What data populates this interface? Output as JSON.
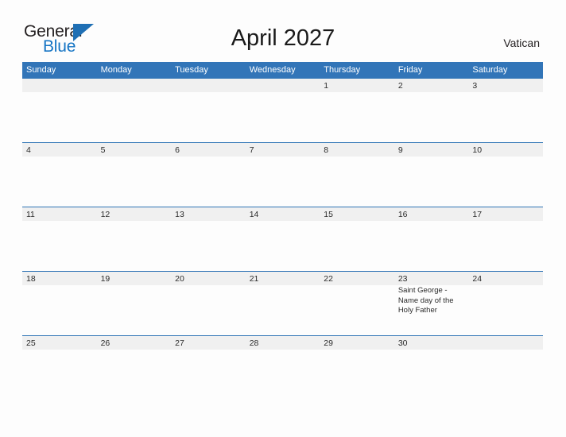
{
  "brand": {
    "name_part1": "General",
    "name_part2": "Blue",
    "triangle_icon": "triangle-icon",
    "accent_blue": "#1f6fb4",
    "text_blue": "#1474c4"
  },
  "header": {
    "title": "April 2027",
    "region": "Vatican"
  },
  "calendar": {
    "header_bg": "#3275b8",
    "band_bg": "#f0f0f0",
    "row_border": "#2f74b5",
    "weekdays": [
      "Sunday",
      "Monday",
      "Tuesday",
      "Wednesday",
      "Thursday",
      "Friday",
      "Saturday"
    ],
    "weeks": [
      [
        {
          "day": "",
          "event": ""
        },
        {
          "day": "",
          "event": ""
        },
        {
          "day": "",
          "event": ""
        },
        {
          "day": "",
          "event": ""
        },
        {
          "day": "1",
          "event": ""
        },
        {
          "day": "2",
          "event": ""
        },
        {
          "day": "3",
          "event": ""
        }
      ],
      [
        {
          "day": "4",
          "event": ""
        },
        {
          "day": "5",
          "event": ""
        },
        {
          "day": "6",
          "event": ""
        },
        {
          "day": "7",
          "event": ""
        },
        {
          "day": "8",
          "event": ""
        },
        {
          "day": "9",
          "event": ""
        },
        {
          "day": "10",
          "event": ""
        }
      ],
      [
        {
          "day": "11",
          "event": ""
        },
        {
          "day": "12",
          "event": ""
        },
        {
          "day": "13",
          "event": ""
        },
        {
          "day": "14",
          "event": ""
        },
        {
          "day": "15",
          "event": ""
        },
        {
          "day": "16",
          "event": ""
        },
        {
          "day": "17",
          "event": ""
        }
      ],
      [
        {
          "day": "18",
          "event": ""
        },
        {
          "day": "19",
          "event": ""
        },
        {
          "day": "20",
          "event": ""
        },
        {
          "day": "21",
          "event": ""
        },
        {
          "day": "22",
          "event": ""
        },
        {
          "day": "23",
          "event": "Saint George - Name day of the Holy Father"
        },
        {
          "day": "24",
          "event": ""
        }
      ],
      [
        {
          "day": "25",
          "event": ""
        },
        {
          "day": "26",
          "event": ""
        },
        {
          "day": "27",
          "event": ""
        },
        {
          "day": "28",
          "event": ""
        },
        {
          "day": "29",
          "event": ""
        },
        {
          "day": "30",
          "event": ""
        },
        {
          "day": "",
          "event": ""
        }
      ]
    ]
  }
}
